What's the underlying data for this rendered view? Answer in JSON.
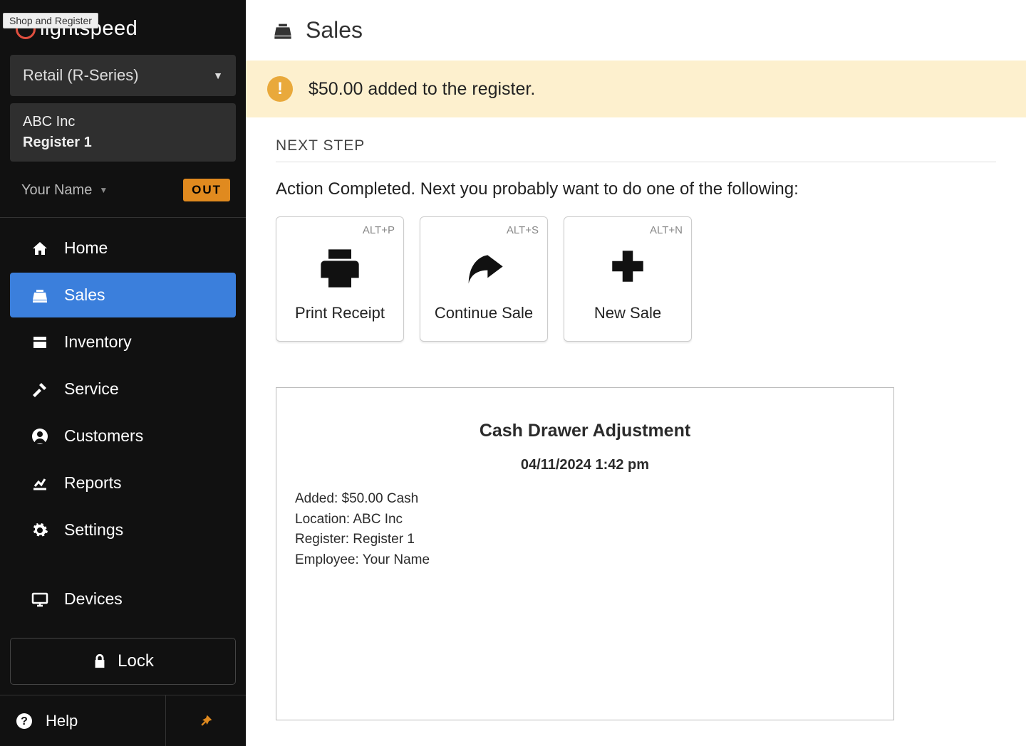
{
  "tooltip": "Shop and Register",
  "brand": "lightspeed",
  "product_selector": "Retail (R-Series)",
  "shop": {
    "name": "ABC Inc",
    "register": "Register 1"
  },
  "user": {
    "name": "Your Name",
    "status_badge": "OUT"
  },
  "nav": {
    "home": "Home",
    "sales": "Sales",
    "inventory": "Inventory",
    "service": "Service",
    "customers": "Customers",
    "reports": "Reports",
    "settings": "Settings",
    "devices": "Devices"
  },
  "lock_label": "Lock",
  "help_label": "Help",
  "page_title": "Sales",
  "banner": "$50.00 added to the register.",
  "next_step_label": "NEXT STEP",
  "hint": "Action Completed. Next you probably want to do one of the following:",
  "cards": {
    "print": {
      "label": "Print Receipt",
      "shortcut": "ALT+P"
    },
    "continue": {
      "label": "Continue Sale",
      "shortcut": "ALT+S"
    },
    "new": {
      "label": "New Sale",
      "shortcut": "ALT+N"
    }
  },
  "receipt": {
    "title": "Cash Drawer Adjustment",
    "datetime": "04/11/2024 1:42 pm",
    "added": "Added: $50.00 Cash",
    "location": "Location: ABC Inc",
    "register": "Register: Register 1",
    "employee": "Employee: Your Name"
  }
}
